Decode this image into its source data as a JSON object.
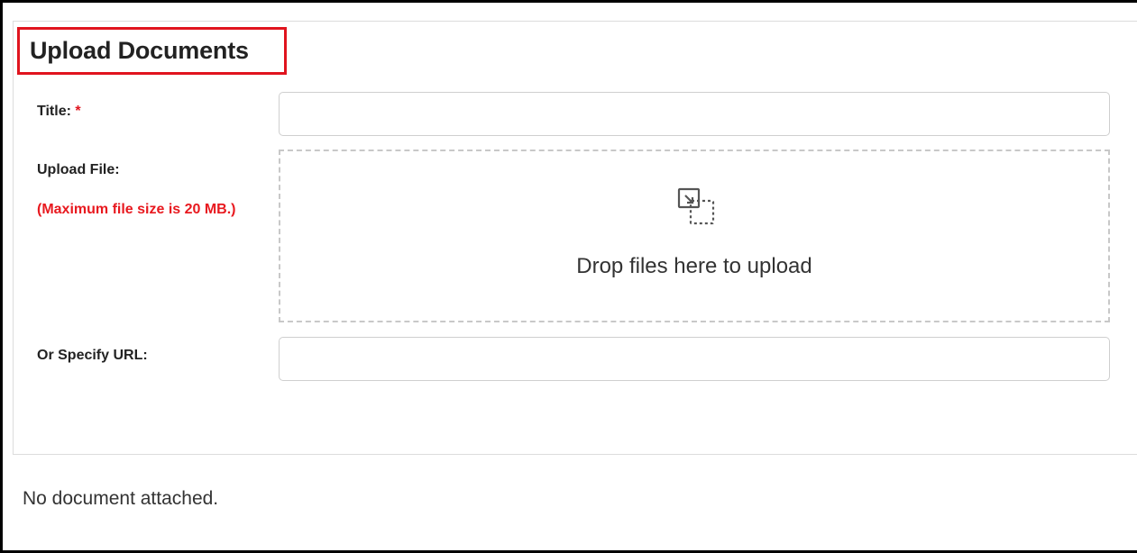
{
  "section": {
    "title": "Upload Documents"
  },
  "form": {
    "title_label": "Title:",
    "required_marker": "*",
    "title_value": "",
    "upload_label": "Upload File:",
    "max_size_note": "(Maximum file size is 20 MB.)",
    "dropzone_text": "Drop files here to upload",
    "dropzone_icon": "drop-files-icon",
    "url_label": "Or Specify URL:",
    "url_value": ""
  },
  "status": {
    "attachment_text": "No document attached."
  },
  "colors": {
    "highlight_border": "#e0141e",
    "required_red": "#e8191f",
    "dashed_border": "#c8c8c8"
  }
}
